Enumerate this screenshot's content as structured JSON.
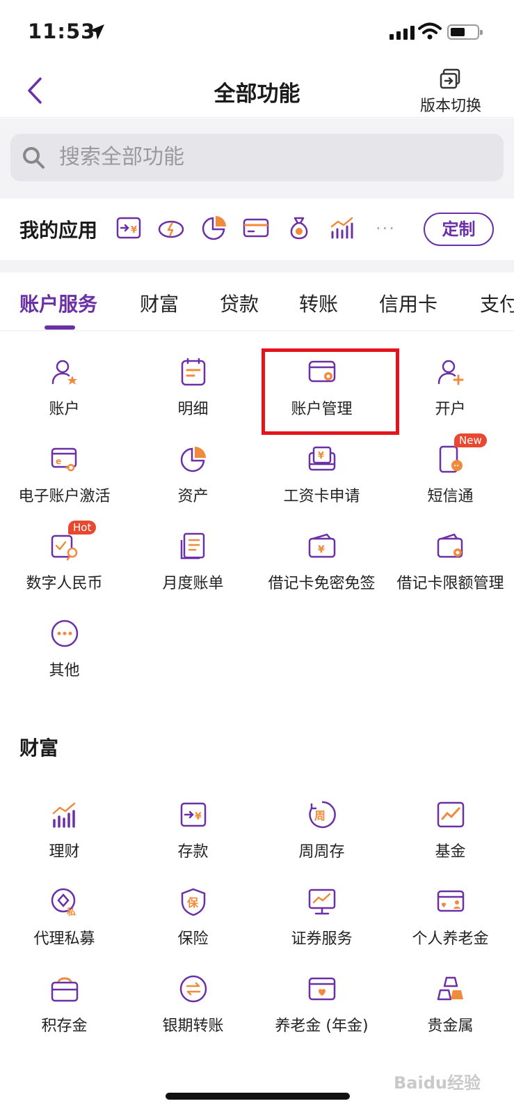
{
  "status": {
    "time": "11:53"
  },
  "header": {
    "title": "全部功能",
    "switch_label": "版本切换"
  },
  "search": {
    "placeholder": "搜索全部功能"
  },
  "my_apps": {
    "title": "我的应用",
    "more": "...",
    "custom_label": "定制"
  },
  "tabs": [
    "账户服务",
    "财富",
    "贷款",
    "转账",
    "信用卡",
    "支付"
  ],
  "account_services": [
    {
      "label": "账户",
      "icon": "user-star-icon"
    },
    {
      "label": "明细",
      "icon": "detail-list-icon"
    },
    {
      "label": "账户管理",
      "icon": "card-gear-icon"
    },
    {
      "label": "开户",
      "icon": "user-add-icon"
    },
    {
      "label": "电子账户激活",
      "icon": "ecard-key-icon"
    },
    {
      "label": "资产",
      "icon": "pie-chart-icon"
    },
    {
      "label": "工资卡申请",
      "icon": "salary-card-icon"
    },
    {
      "label": "短信通",
      "icon": "phone-message-icon",
      "badge": "New"
    },
    {
      "label": "数字人民币",
      "icon": "digital-rmb-icon",
      "badge": "Hot"
    },
    {
      "label": "月度账单",
      "icon": "monthly-bill-icon"
    },
    {
      "label": "借记卡免密免签",
      "icon": "debit-card-yuan-icon"
    },
    {
      "label": "借记卡限额管理",
      "icon": "wallet-gear-icon"
    },
    {
      "label": "其他",
      "icon": "more-circle-icon"
    }
  ],
  "wealth": {
    "title": "财富",
    "items": [
      {
        "label": "理财",
        "icon": "bar-trend-icon"
      },
      {
        "label": "存款",
        "icon": "deposit-icon"
      },
      {
        "label": "周周存",
        "icon": "weekly-icon"
      },
      {
        "label": "基金",
        "icon": "fund-chart-icon"
      },
      {
        "label": "代理私募",
        "icon": "private-fund-icon"
      },
      {
        "label": "保险",
        "icon": "insurance-shield-icon"
      },
      {
        "label": "证券服务",
        "icon": "securities-monitor-icon"
      },
      {
        "label": "个人养老金",
        "icon": "pension-card-icon"
      },
      {
        "label": "积存金",
        "icon": "gold-bag-icon"
      },
      {
        "label": "银期转账",
        "icon": "exchange-circle-icon"
      },
      {
        "label": "养老金 (年金)",
        "icon": "annuity-card-icon"
      },
      {
        "label": "贵金属",
        "icon": "gold-bars-icon"
      }
    ]
  },
  "colors": {
    "brand": "#6b2fa6",
    "accent": "#f08a3c",
    "highlight": "#e3141b"
  },
  "watermark": "Baidu经验"
}
